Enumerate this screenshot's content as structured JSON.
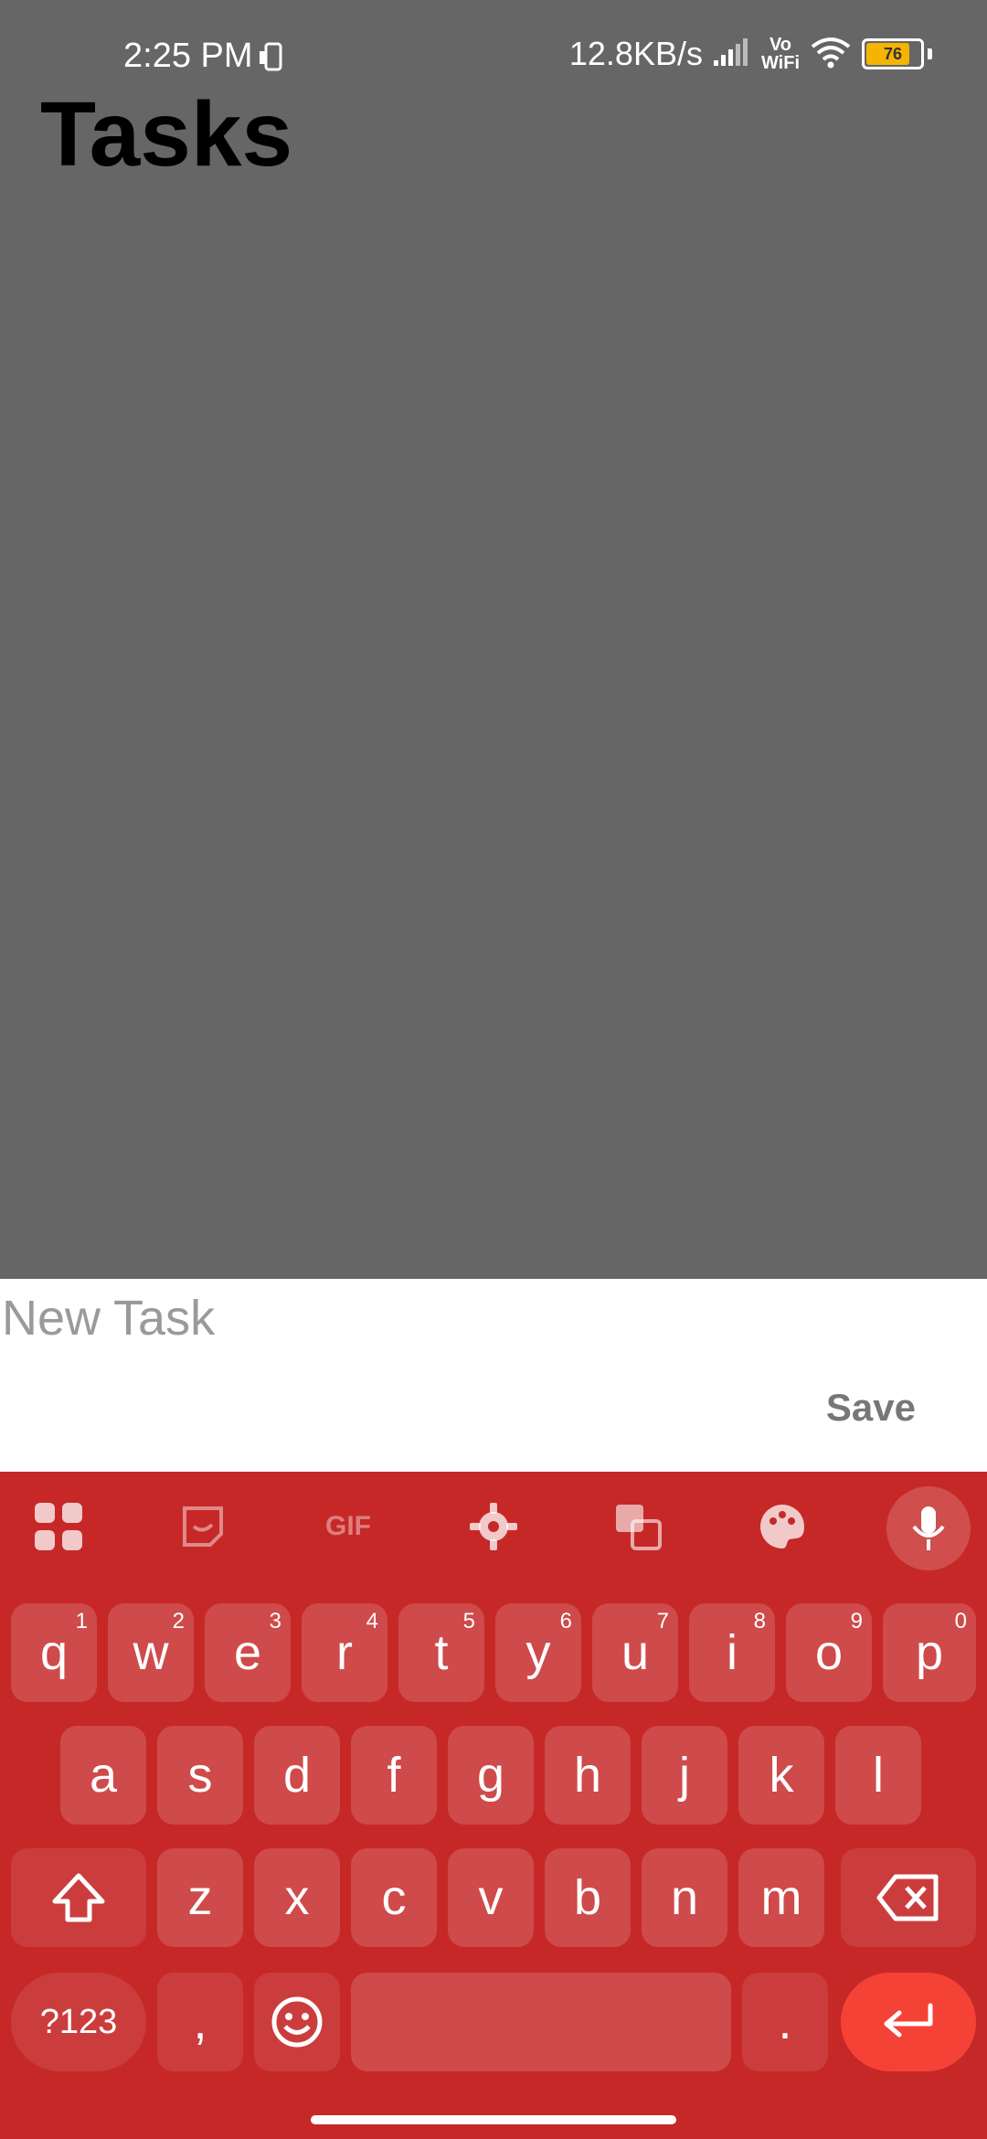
{
  "status_bar": {
    "time": "2:25 PM",
    "net_speed": "12.8KB/s",
    "vowifi_top": "Vo",
    "vowifi_bottom": "WiFi",
    "battery": "76"
  },
  "app": {
    "title": "Tasks"
  },
  "task_panel": {
    "input_placeholder": "New Task",
    "input_value": "",
    "save_label": "Save"
  },
  "keyboard": {
    "toolbar_icons": [
      "apps-icon",
      "sticker-icon",
      "gif-icon",
      "gear-icon",
      "translate-icon",
      "palette-icon",
      "mic-icon"
    ],
    "gif_label": "GIF",
    "row1": [
      {
        "key": "q",
        "hint": "1"
      },
      {
        "key": "w",
        "hint": "2"
      },
      {
        "key": "e",
        "hint": "3"
      },
      {
        "key": "r",
        "hint": "4"
      },
      {
        "key": "t",
        "hint": "5"
      },
      {
        "key": "y",
        "hint": "6"
      },
      {
        "key": "u",
        "hint": "7"
      },
      {
        "key": "i",
        "hint": "8"
      },
      {
        "key": "o",
        "hint": "9"
      },
      {
        "key": "p",
        "hint": "0"
      }
    ],
    "row2": [
      "a",
      "s",
      "d",
      "f",
      "g",
      "h",
      "j",
      "k",
      "l"
    ],
    "row3": [
      "z",
      "x",
      "c",
      "v",
      "b",
      "n",
      "m"
    ],
    "symbols_label": "?123",
    "comma_label": ",",
    "period_label": ".",
    "accent_color": "#c62828",
    "enter_color": "#f44336"
  }
}
